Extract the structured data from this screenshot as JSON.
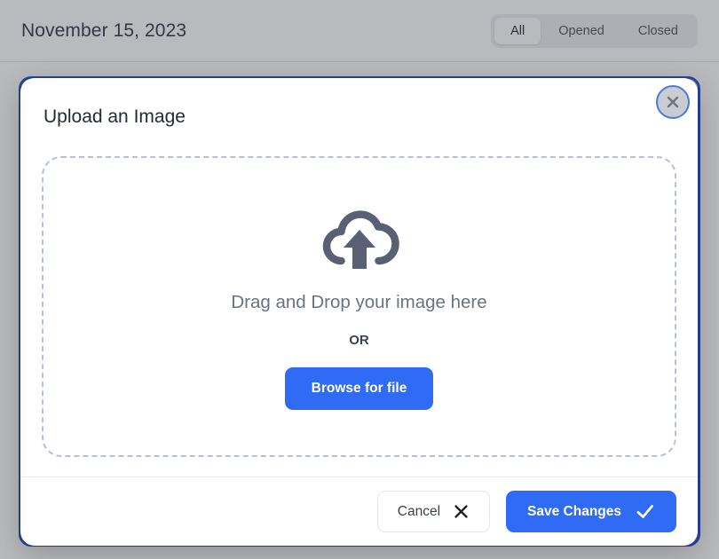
{
  "page": {
    "date_label": "November 15, 2023",
    "filters": [
      {
        "label": "All",
        "active": true
      },
      {
        "label": "Opened",
        "active": false
      },
      {
        "label": "Closed",
        "active": false
      }
    ]
  },
  "modal": {
    "title": "Upload an Image",
    "close_icon": "close-icon",
    "dropzone": {
      "icon": "cloud-upload-icon",
      "drag_text": "Drag and Drop your image here",
      "or_text": "OR",
      "browse_label": "Browse for file"
    },
    "footer": {
      "cancel_label": "Cancel",
      "cancel_icon": "x-icon",
      "save_label": "Save Changes",
      "save_icon": "check-icon"
    }
  },
  "colors": {
    "accent_blue": "#2f6bf5",
    "card_border_blue": "#1e49c4",
    "dashed_border": "#b8bedd",
    "icon_slate": "#5a6074",
    "overlay": "rgba(60,64,72,0.36)"
  }
}
